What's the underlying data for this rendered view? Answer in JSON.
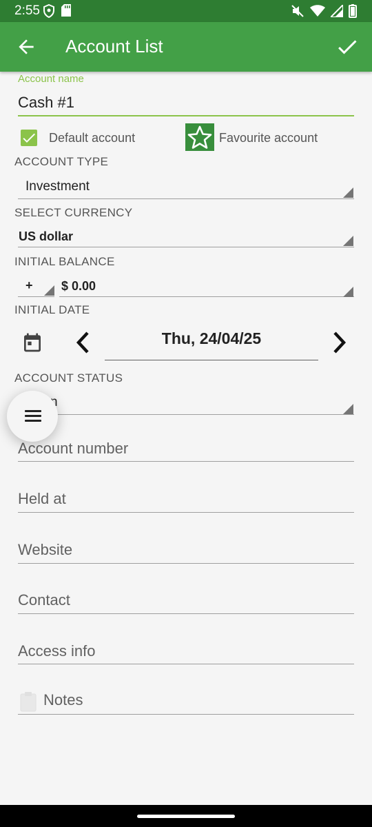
{
  "status_bar": {
    "time": "2:55",
    "left_icons": [
      "shield-icon",
      "sd-card-icon"
    ],
    "right_icons": [
      "mute-icon",
      "wifi-icon",
      "signal-icon",
      "battery-icon"
    ]
  },
  "app_bar": {
    "title": "Account List",
    "back_icon": "arrow-back-icon",
    "confirm_icon": "check-icon",
    "color": "#43a047"
  },
  "form": {
    "account_name": {
      "label": "Account name",
      "value": "Cash #1"
    },
    "default_account": {
      "label": "Default account",
      "checked": true
    },
    "favourite_account": {
      "label": "Favourite account",
      "checked": false
    },
    "account_type": {
      "label": "ACCOUNT TYPE",
      "value": "Investment"
    },
    "currency": {
      "label": "SELECT CURRENCY",
      "value": "US dollar"
    },
    "initial_balance": {
      "label": "INITIAL BALANCE",
      "sign": "+",
      "value": "$ 0.00"
    },
    "initial_date": {
      "label": "INITIAL DATE",
      "value": "Thu, 24/04/25"
    },
    "account_status": {
      "label": "ACCOUNT STATUS",
      "value_partial": "n"
    },
    "account_number": {
      "placeholder": "Account number"
    },
    "held_at": {
      "placeholder": "Held at"
    },
    "website": {
      "placeholder": "Website"
    },
    "contact": {
      "placeholder": "Contact"
    },
    "access_info": {
      "placeholder": "Access info"
    },
    "notes": {
      "placeholder": "Notes"
    }
  },
  "fab": {
    "icon": "menu-icon"
  },
  "accent": "#8bc34a"
}
